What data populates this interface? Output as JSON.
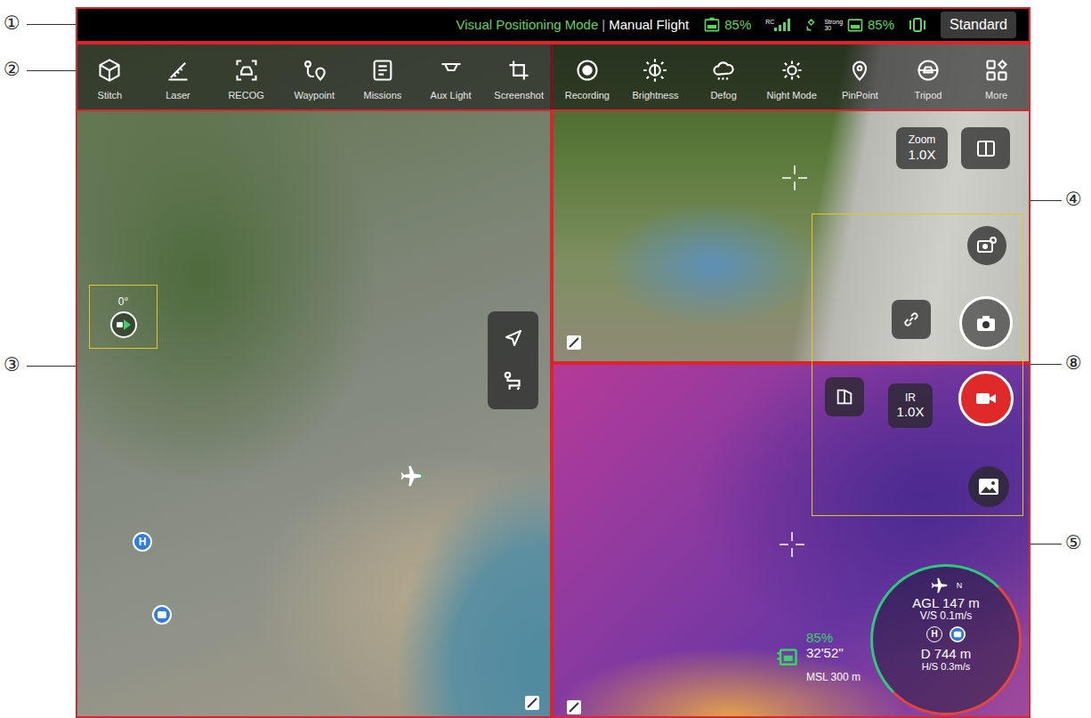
{
  "callouts": [
    {
      "label": "①",
      "side": "left"
    },
    {
      "label": "②",
      "side": "left"
    },
    {
      "label": "③",
      "side": "left"
    },
    {
      "label": "④",
      "side": "right"
    },
    {
      "label": "⑧",
      "side": "right"
    },
    {
      "label": "⑤",
      "side": "right"
    }
  ],
  "status_bar": {
    "mode": "Visual Positioning Mode",
    "separator": "|",
    "flight": "Manual Flight",
    "aircraft_battery": "85%",
    "rc_label": "RC",
    "gps_label": "Strong",
    "gps_count": "30",
    "rc_battery": "85%",
    "profile": "Standard"
  },
  "toolbar": [
    {
      "label": "Stitch"
    },
    {
      "label": "Laser"
    },
    {
      "label": "RECOG"
    },
    {
      "label": "Waypoint"
    },
    {
      "label": "Missions"
    },
    {
      "label": "Aux Light"
    },
    {
      "label": "Screenshot"
    },
    {
      "label": "Recording"
    },
    {
      "label": "Brightness"
    },
    {
      "label": "Defog"
    },
    {
      "label": "Night Mode"
    },
    {
      "label": "PinPoint"
    },
    {
      "label": "Tripod"
    },
    {
      "label": "More"
    }
  ],
  "map": {
    "heading": "0°",
    "home_marker": "H"
  },
  "camera": {
    "zoom_label": "Zoom",
    "zoom": "1.0X"
  },
  "thermal": {
    "ir_label": "IR",
    "ir_zoom": "1.0X"
  },
  "telemetry": {
    "north": "N",
    "agl": "AGL 147 m",
    "vs": "V/S 0.1m/s",
    "home": "H",
    "distance": "D 744 m",
    "hs": "H/S 0.3m/s",
    "battery": "85%",
    "flight_time": "32'52''",
    "msl": "MSL 300 m"
  }
}
